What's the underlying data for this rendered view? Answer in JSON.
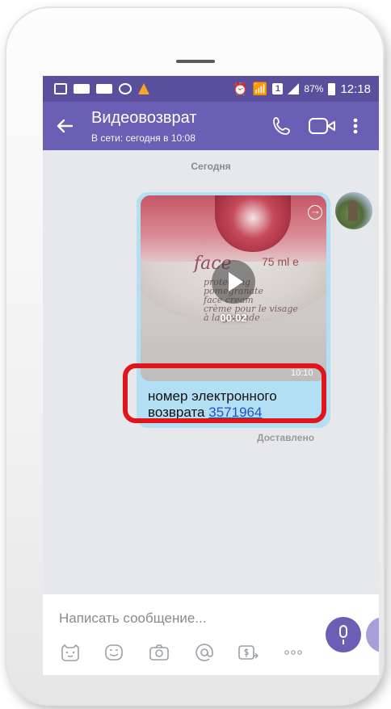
{
  "status_bar": {
    "battery_percent": "87%",
    "time": "12:18",
    "sim_number": "1"
  },
  "header": {
    "back_icon": "arrow-left-icon",
    "title": "Видеовозврат",
    "subtitle": "В сети: сегодня в 10:08",
    "call_icon": "phone-icon",
    "video_icon": "video-camera-icon",
    "menu_icon": "more-vert-icon"
  },
  "chat": {
    "day_separator": "Сегодня",
    "message": {
      "video_duration": "00:02",
      "time": "10:10",
      "caption_text": "номер электронного возврата ",
      "caption_link": "3571964",
      "product_brand": "face",
      "product_volume": "75 ml e",
      "product_lines": [
        "protecting",
        "pomegranate",
        "face cream",
        "crème pour le visage",
        "à la grenade"
      ],
      "status": "Доставлено"
    }
  },
  "composer": {
    "placeholder": "Написать сообщение...",
    "tools": [
      "sticker-icon",
      "emoji-icon",
      "camera-icon",
      "mention-icon",
      "money-transfer-icon",
      "more-horiz-icon"
    ],
    "mic_icon": "microphone-icon"
  },
  "colors": {
    "status_bar": "#594f9d",
    "app_bar": "#6a5fb4",
    "bubble": "#b3dff4",
    "highlight": "#e0151b",
    "chat_background": "#e7e8eb"
  }
}
